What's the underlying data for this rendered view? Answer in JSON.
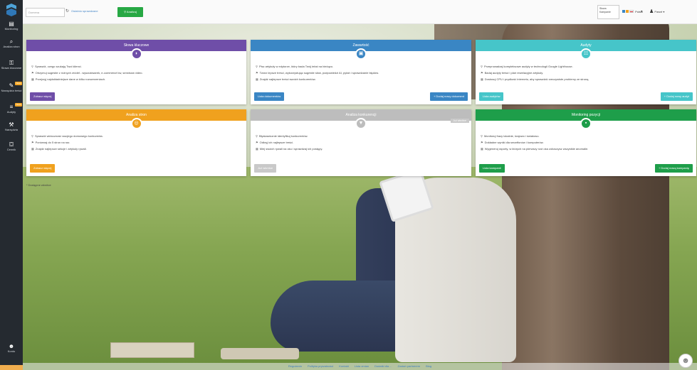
{
  "topbar": {
    "search_placeholder": "Domena",
    "last_keywords": "Ostatnio sprawdzane",
    "analyze_label": "Analizuj",
    "kw_box": [
      "Słowa",
      "Kampanie"
    ],
    "lang": "Polski",
    "user": "Paweł"
  },
  "sidebar": {
    "items": [
      {
        "label": "Monitoring",
        "icon": "bar-chart-icon"
      },
      {
        "label": "Analiza stron",
        "icon": "search-icon"
      },
      {
        "label": "Słowa kluczowe",
        "icon": "key-icon"
      },
      {
        "label": "Narzędzia treści",
        "icon": "edit-icon",
        "badge": "Nowe"
      },
      {
        "label": "Audyty",
        "icon": "list-icon",
        "badge": "Nowe"
      },
      {
        "label": "Narzędzia",
        "icon": "wrench-icon"
      },
      {
        "label": "Cennik",
        "icon": "cart-icon"
      }
    ],
    "user_label": "Konto"
  },
  "cards": [
    {
      "title": "Słowa kluczowe",
      "color": "#6f4ea8",
      "icon": "◗",
      "lines": [
        "Sprawdź, czego szukają Twoi klienci.",
        "Otrzymuj sugestie z różnych źródeł - wyszukiwarek, e-commerce'ów, serwisów video.",
        "Przejrzyj najdokładniejsze dane w kilku rozszerzeniach."
      ],
      "btn_left": "Zobacz więcej",
      "btn_left_color": "#6f4ea8"
    },
    {
      "title": "Zawartość",
      "color": "#3a86c4",
      "icon": "▣",
      "lines": [
        "Pisz artykuły w edytorze, który bada Twój tekst na bieżąco.",
        "Twórz lepsze treści, wykorzystując sugestie słów, podpowiedzi AI, pytań i sprawdzanie błędów.",
        "Znajdź najlepsze treści swoich konkurentów."
      ],
      "btn_left": "Lista dokumentów",
      "btn_left_color": "#3a86c4",
      "btn_right": "+ Dodaj nowy dokument",
      "btn_right_color": "#3a86c4"
    },
    {
      "title": "Audyty",
      "color": "#46c5c9",
      "icon": "☷",
      "lines": [
        "Przeprowadzaj kompleksowe audyty w technologii Google Lighthouse.",
        "Badaj audyty treści i plań rewelacyjne artykuły.",
        "Dostosuj CPU i prędkość internetu, aby sprawdzić rzeczywiste problemy ze stroną."
      ],
      "btn_left": "Lista audytów",
      "btn_left_color": "#46c5c9",
      "btn_right": "+ Dodaj nowy audyt",
      "btn_right_color": "#46c5c9"
    },
    {
      "title": "Analiza stron",
      "color": "#f0a11e",
      "icon": "◎",
      "lines": [
        "Sprawdź widoczność swojego domowego konkurenta.",
        "Porównaj do 5 stron na raz.",
        "Znajdź najlepsze sekcje i artykuły rywali."
      ],
      "btn_left": "Zobacz więcej",
      "btn_left_color": "#f0a11e"
    },
    {
      "title": "Analiza konkurencji",
      "color": "#bdbdbd",
      "icon": "▼",
      "tag": "Już wkrótce",
      "lines": [
        "Błyskawicznie identyfikuj konkurentów.",
        "Odkryj ich najlepsze treści.",
        "Miej swoich rywali na oku i sprawdzaj ich postępy."
      ],
      "btn_left": "Już wkrótce",
      "btn_left_color": "#c9c9c9"
    },
    {
      "title": "Monitoring pozycji",
      "color": "#1e9e4a",
      "icon": "▪",
      "lines": [
        "Monitoruj frazy lokalnie, krajowo i światowo.",
        "Dokładne wyniki dla smartfonów i komputerów.",
        "Wygeneruj raporty, w których na pierwszy rzut oka zobaczysz wszystkie anomalie."
      ],
      "btn_left": "Lista kampanii",
      "btn_left_color": "#1e9e4a",
      "btn_right": "+ Dodaj nową kampanię",
      "btn_right_color": "#1e9e4a"
    }
  ],
  "note": "* Dostępne wkrótce",
  "footer": [
    "Regulamin",
    "Polityka prywatności",
    "Kontakt",
    "Lista zmian",
    "Dodatki dla ...",
    "Zostań partnerem",
    "Blog"
  ]
}
